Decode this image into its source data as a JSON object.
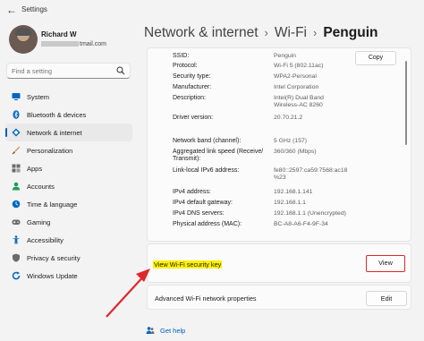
{
  "window": {
    "title": "Settings",
    "back_icon": "back-arrow-icon"
  },
  "profile": {
    "name": "Richard W",
    "email_suffix": "tmail.com"
  },
  "search": {
    "placeholder": "Find a setting",
    "icon": "search-icon"
  },
  "sidebar": {
    "items": [
      {
        "label": "System",
        "icon": "monitor-icon",
        "color": "#0067c0",
        "active": false
      },
      {
        "label": "Bluetooth & devices",
        "icon": "bluetooth-icon",
        "color": "#0067c0",
        "active": false
      },
      {
        "label": "Network & internet",
        "icon": "wifi-diamond-icon",
        "color": "#0067c0",
        "active": true
      },
      {
        "label": "Personalization",
        "icon": "brush-icon",
        "color": "#d9762b",
        "active": false
      },
      {
        "label": "Apps",
        "icon": "apps-icon",
        "color": "#6b6b6b",
        "active": false
      },
      {
        "label": "Accounts",
        "icon": "person-icon",
        "color": "#1c9e5c",
        "active": false
      },
      {
        "label": "Time & language",
        "icon": "globe-clock-icon",
        "color": "#0067c0",
        "active": false
      },
      {
        "label": "Gaming",
        "icon": "gamepad-icon",
        "color": "#6b6b6b",
        "active": false
      },
      {
        "label": "Accessibility",
        "icon": "accessibility-icon",
        "color": "#0067c0",
        "active": false
      },
      {
        "label": "Privacy & security",
        "icon": "shield-icon",
        "color": "#6b6b6b",
        "active": false
      },
      {
        "label": "Windows Update",
        "icon": "update-icon",
        "color": "#0067c0",
        "active": false
      }
    ]
  },
  "header": {
    "crumbs": [
      "Network & internet",
      "Wi-Fi"
    ],
    "current": "Penguin"
  },
  "properties": {
    "copy_label": "Copy",
    "rows": [
      {
        "label": "SSID:",
        "value": "Penguin"
      },
      {
        "label": "Protocol:",
        "value": "Wi-Fi 5 (802.11ac)"
      },
      {
        "label": "Security type:",
        "value": "WPA2-Personal"
      },
      {
        "label": "Manufacturer:",
        "value": "Intel Corporation"
      },
      {
        "label": "Description:",
        "value": "Intel(R) Dual Band Wireless-AC 8260"
      },
      {
        "label": "Driver version:",
        "value": "20.70.21.2"
      },
      {
        "label": "Network band (channel):",
        "value": "5 GHz (157)"
      },
      {
        "label": "Aggregated link speed (Receive/ Transmit):",
        "value": "360/360 (Mbps)"
      },
      {
        "label": "Link-local IPv6 address:",
        "value": "fe80::2597:ca59:7568:ac18 %23"
      },
      {
        "label": "IPv4 address:",
        "value": "192.168.1.141"
      },
      {
        "label": "IPv4 default gateway:",
        "value": "192.168.1.1"
      },
      {
        "label": "IPv4 DNS servers:",
        "value": "192.168.1.1 (Unencrypted)"
      },
      {
        "label": "Physical address (MAC):",
        "value": "BC-A8-A6-F4-9F-34"
      }
    ]
  },
  "security_key": {
    "label": "View Wi-Fi security key",
    "button": "View",
    "highlight_color": "#fff200",
    "button_outline_color": "#e0262b"
  },
  "advanced": {
    "label": "Advanced Wi-Fi network properties",
    "button": "Edit"
  },
  "help": {
    "label": "Get help",
    "icon": "help-people-icon"
  },
  "colors": {
    "accent": "#005fb8",
    "annotation_red": "#e0262b"
  }
}
